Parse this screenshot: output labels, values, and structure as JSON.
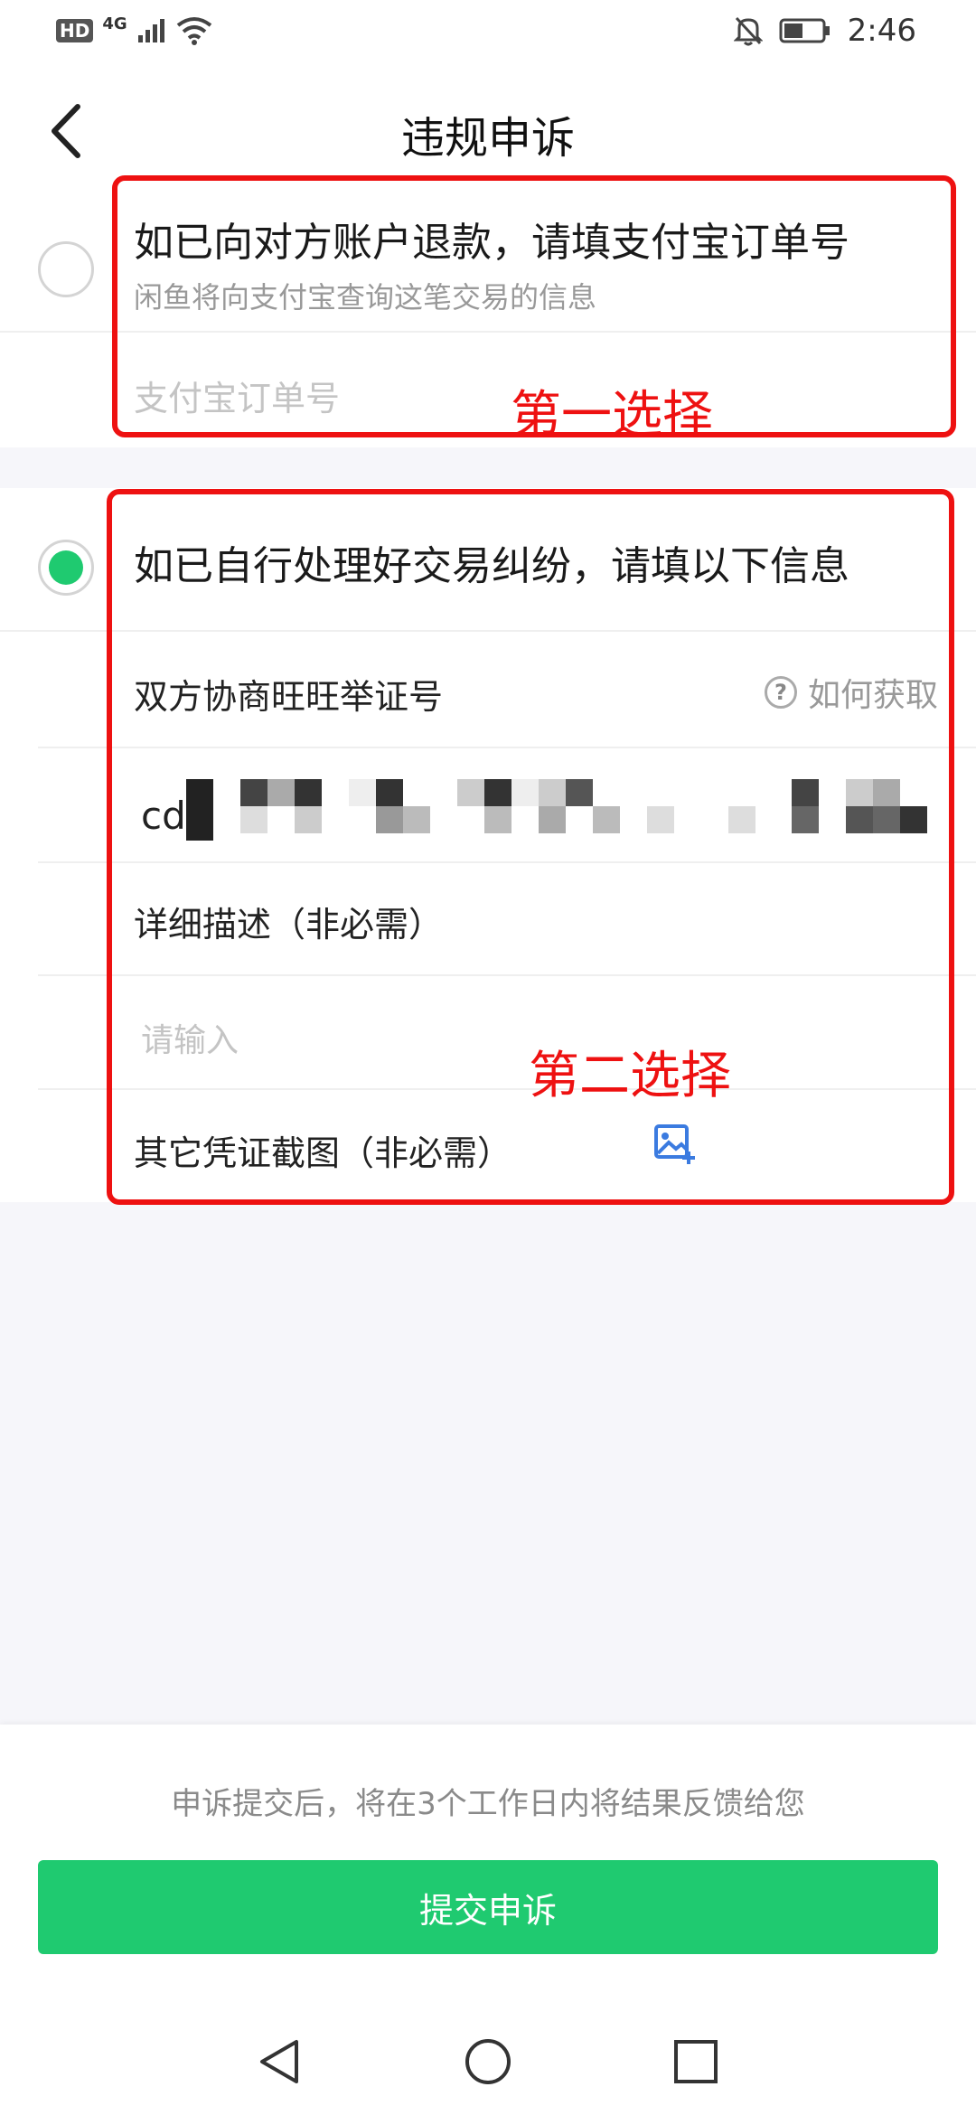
{
  "status_bar": {
    "hd": "HD",
    "network": "4G",
    "time": "2:46"
  },
  "header": {
    "title": "违规申诉"
  },
  "option1": {
    "title": "如已向对方账户退款，请填支付宝订单号",
    "subtitle": "闲鱼将向支付宝查询这笔交易的信息",
    "input_placeholder": "支付宝订单号",
    "selected": false,
    "annotation": "第一选择"
  },
  "option2": {
    "title": "如已自行处理好交易纠纷，请填以下信息",
    "selected": true,
    "proof_label": "双方协商旺旺举证号",
    "help_icon_glyph": "?",
    "help_link": "如何获取",
    "proof_value_visible": "cd",
    "description_label": "详细描述（非必需）",
    "description_placeholder": "请输入",
    "screenshot_label": "其它凭证截图（非必需）",
    "annotation": "第二选择"
  },
  "footer": {
    "notice": "申诉提交后，将在3个工作日内将结果反馈给您",
    "submit_label": "提交申诉"
  },
  "colors": {
    "accent_green": "#1fca70",
    "annotation_red": "#ee1111",
    "link_blue": "#3b7be0"
  },
  "icons": {
    "back": "chevron-left-icon",
    "help": "question-circle-icon",
    "add_image": "add-image-icon",
    "nav_back": "triangle-back-icon",
    "nav_home": "circle-home-icon",
    "nav_recent": "square-recent-icon"
  }
}
